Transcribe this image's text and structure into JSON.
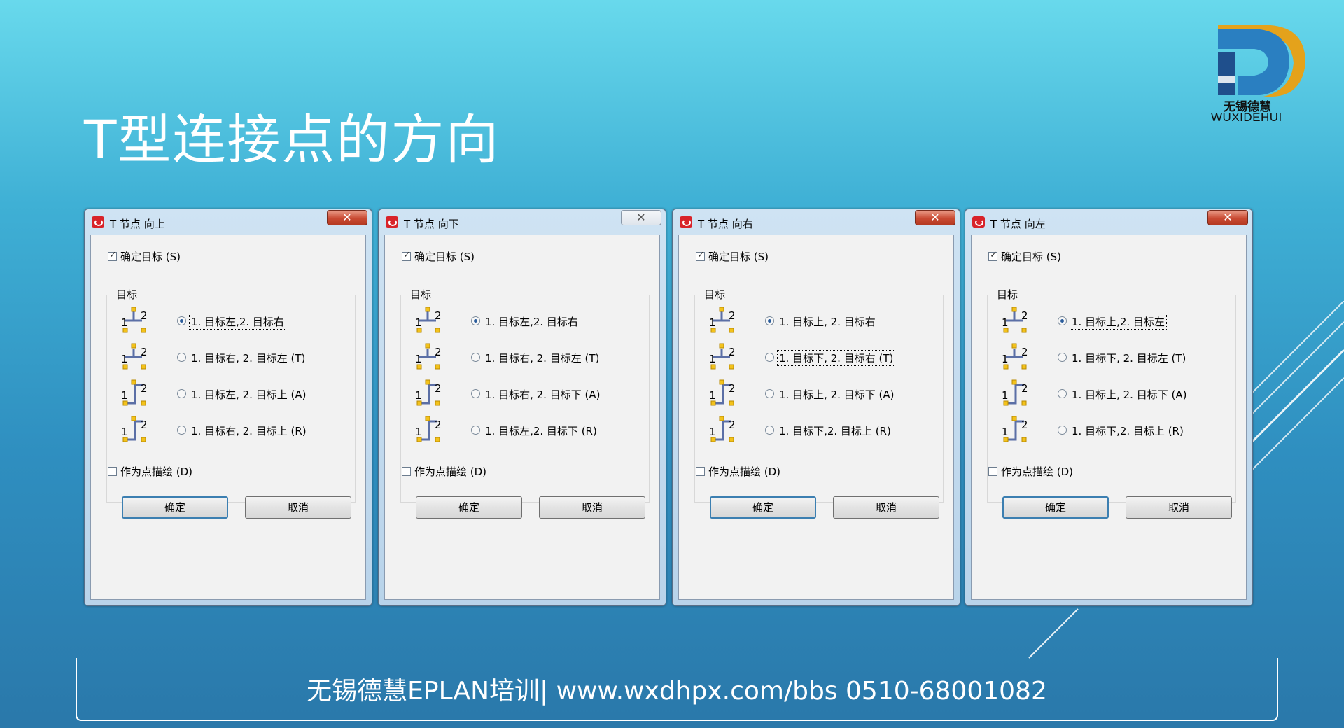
{
  "slide": {
    "title": "T型连接点的方向",
    "footer": "无锡德慧EPLAN培训| www.wxdhpx.com/bbs  0510-68001082"
  },
  "logo": {
    "name_cn": "无锡德慧",
    "name_en": "WUXIDEHUI",
    "colors": {
      "blue": "#2a7fc1",
      "gold": "#e4a21b",
      "dark": "#1f4f8c"
    }
  },
  "close_glyph": "✕",
  "dialogs": [
    {
      "title": "T 节点 向上",
      "close_active": true,
      "determine_target_label": "确定目标 (S)",
      "determine_target_checked": true,
      "target_group_label": "目标",
      "options": [
        {
          "label": "1. 目标左,2. 目标右",
          "selected": true,
          "focused": true,
          "icon": "t-node-up-left-right-icon"
        },
        {
          "label": "1. 目标右, 2. 目标左 (T)",
          "selected": false,
          "focused": false,
          "icon": "t-node-up-right-left-icon"
        },
        {
          "label": "1. 目标左, 2. 目标上 (A)",
          "selected": false,
          "focused": false,
          "icon": "t-node-up-left-up-icon"
        },
        {
          "label": "1. 目标右, 2. 目标上 (R)",
          "selected": false,
          "focused": false,
          "icon": "t-node-up-right-up-icon"
        }
      ],
      "as_point_label": "作为点描绘 (D)",
      "as_point_checked": false,
      "ok_label": "确定",
      "cancel_label": "取消"
    },
    {
      "title": "T 节点 向下",
      "close_active": false,
      "determine_target_label": "确定目标 (S)",
      "determine_target_checked": true,
      "target_group_label": "目标",
      "options": [
        {
          "label": "1. 目标左,2. 目标右",
          "selected": true,
          "focused": false,
          "icon": "t-node-down-left-right-icon"
        },
        {
          "label": "1. 目标右, 2. 目标左 (T)",
          "selected": false,
          "focused": false,
          "icon": "t-node-down-right-left-icon"
        },
        {
          "label": "1. 目标右, 2. 目标下 (A)",
          "selected": false,
          "focused": false,
          "icon": "t-node-down-right-down-icon"
        },
        {
          "label": "1. 目标左,2. 目标下 (R)",
          "selected": false,
          "focused": false,
          "icon": "t-node-down-left-down-icon"
        }
      ],
      "as_point_label": "作为点描绘 (D)",
      "as_point_checked": false,
      "ok_label": "确定",
      "cancel_label": "取消"
    },
    {
      "title": "T 节点 向右",
      "close_active": true,
      "determine_target_label": "确定目标 (S)",
      "determine_target_checked": true,
      "target_group_label": "目标",
      "options": [
        {
          "label": "1. 目标上, 2. 目标右",
          "selected": true,
          "focused": false,
          "icon": "t-node-right-up-right-icon"
        },
        {
          "label": "1. 目标下, 2. 目标右 (T)",
          "selected": false,
          "focused": true,
          "icon": "t-node-right-down-right-icon"
        },
        {
          "label": "1. 目标上, 2. 目标下 (A)",
          "selected": false,
          "focused": false,
          "icon": "t-node-right-up-down-icon"
        },
        {
          "label": "1. 目标下,2. 目标上 (R)",
          "selected": false,
          "focused": false,
          "icon": "t-node-right-down-up-icon"
        }
      ],
      "as_point_label": "作为点描绘 (D)",
      "as_point_checked": false,
      "ok_label": "确定",
      "cancel_label": "取消"
    },
    {
      "title": "T 节点 向左",
      "close_active": true,
      "determine_target_label": "确定目标 (S)",
      "determine_target_checked": true,
      "target_group_label": "目标",
      "options": [
        {
          "label": "1. 目标上,2. 目标左",
          "selected": true,
          "focused": true,
          "icon": "t-node-left-up-left-icon"
        },
        {
          "label": "1. 目标下, 2. 目标左 (T)",
          "selected": false,
          "focused": false,
          "icon": "t-node-left-down-left-icon"
        },
        {
          "label": "1. 目标上, 2. 目标下 (A)",
          "selected": false,
          "focused": false,
          "icon": "t-node-left-up-down-icon"
        },
        {
          "label": "1. 目标下,2. 目标上 (R)",
          "selected": false,
          "focused": false,
          "icon": "t-node-left-down-up-icon"
        }
      ],
      "as_point_label": "作为点描绘 (D)",
      "as_point_checked": false,
      "ok_label": "确定",
      "cancel_label": "取消"
    }
  ],
  "icon_digits": [
    "1",
    "2"
  ],
  "icon_colors": {
    "line": "#5b6fa6",
    "terminal": "#f3c21b",
    "terminal_border": "#b88a00",
    "digit": "#000000"
  }
}
